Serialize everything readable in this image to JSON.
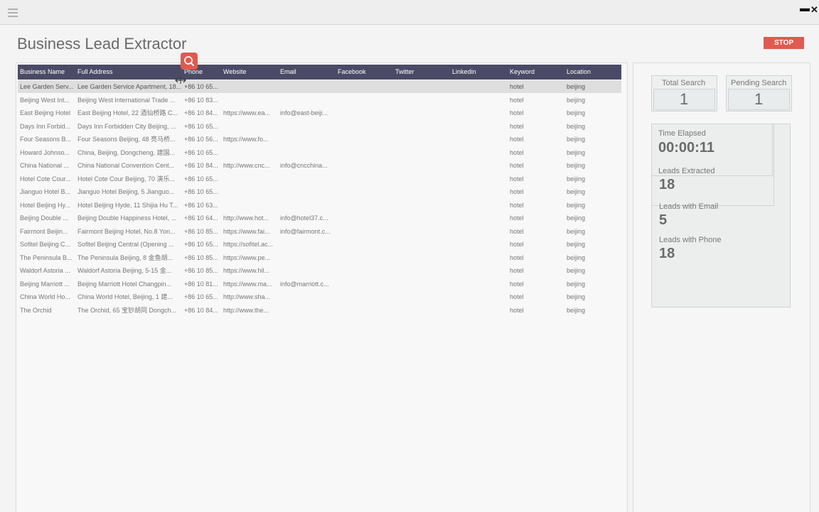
{
  "app": {
    "title": "Business Lead Extractor",
    "stop_label": "STOP",
    "accent_color": "#e05a4f",
    "header_color": "#4b4a66"
  },
  "icons": {
    "menu": "hamburger-icon",
    "minimize": "minimize-icon",
    "close": "close-icon",
    "search": "search-icon",
    "resize": "column-resize-cursor-icon"
  },
  "window": {
    "minimize_glyph": "▬",
    "close_glyph": "✕"
  },
  "table": {
    "columns": [
      "Business Name",
      "Full Address",
      "Phone",
      "Website",
      "Email",
      "Facebook",
      "Twitter",
      "Linkedin",
      "Keyword",
      "Location"
    ],
    "rows": [
      [
        "Lee Garden Serv...",
        "Lee Garden Service Apartment, 18...",
        "+86 10 65...",
        "",
        "",
        "",
        "",
        "",
        "hotel",
        "beijing"
      ],
      [
        "Beijing West Int...",
        "Beijing West International Trade ...",
        "+86 10 83...",
        "",
        "",
        "",
        "",
        "",
        "hotel",
        "beijing"
      ],
      [
        "East Beijing Hotel",
        "East Beijing Hotel, 22 酒仙桥路 C...",
        "+86 10 84...",
        "https://www.ea...",
        "info@east-beiji...",
        "",
        "",
        "",
        "hotel",
        "beijing"
      ],
      [
        "Days Inn Forbid...",
        "Days Inn Forbidden City Beijing, ...",
        "+86 10 65...",
        "",
        "",
        "",
        "",
        "",
        "hotel",
        "beijing"
      ],
      [
        "Four Seasons B...",
        "Four Seasons Beijing, 48 亮马桥...",
        "+86 10 56...",
        "https://www.fo...",
        "",
        "",
        "",
        "",
        "hotel",
        "beijing"
      ],
      [
        "Howard Johnso...",
        "China, Beijing, Dongcheng, 建国...",
        "+86 10 65...",
        "",
        "",
        "",
        "",
        "",
        "hotel",
        "beijing"
      ],
      [
        "China National ...",
        "China National Convention Cent...",
        "+86 10 84...",
        "http://www.cnc...",
        "info@cncchina...",
        "",
        "",
        "",
        "hotel",
        "beijing"
      ],
      [
        "Hotel Cote Cour...",
        "Hotel Cote Cour Beijing, 70 演乐...",
        "+86 10 65...",
        "",
        "",
        "",
        "",
        "",
        "hotel",
        "beijing"
      ],
      [
        "Jianguo Hotel B...",
        "Jianguo Hotel Beijing, 5 Jianguo...",
        "+86 10 65...",
        "",
        "",
        "",
        "",
        "",
        "hotel",
        "beijing"
      ],
      [
        "Hotel Beijing Hy...",
        "Hotel Beijing Hyde, 11 Shijia Hu T...",
        "+86 10 63...",
        "",
        "",
        "",
        "",
        "",
        "hotel",
        "beijing"
      ],
      [
        "Beijing Double ...",
        "Beijing Double Happiness Hotel, ...",
        "+86 10 64...",
        "http://www.hot...",
        "info@hotel37.c...",
        "",
        "",
        "",
        "hotel",
        "beijing"
      ],
      [
        "Fairmont Beijin...",
        "Fairmont Beijing Hotel, No.8 Yon...",
        "+86 10 85...",
        "https://www.fai...",
        "info@fairmont.c...",
        "",
        "",
        "",
        "hotel",
        "beijing"
      ],
      [
        "Sofitel Beijing C...",
        "Sofitel Beijing Central (Opening ...",
        "+86 10 65...",
        "https://sofitel.ac...",
        "",
        "",
        "",
        "",
        "hotel",
        "beijing"
      ],
      [
        "The Peninsula B...",
        "The Peninsula Beijing, 8 金鱼胡...",
        "+86 10 85...",
        "https://www.pe...",
        "",
        "",
        "",
        "",
        "hotel",
        "beijing"
      ],
      [
        "Waldorf Astoria ...",
        "Waldorf Astoria Beijing, 5-15 金...",
        "+86 10 85...",
        "https://www.hil...",
        "",
        "",
        "",
        "",
        "hotel",
        "beijing"
      ],
      [
        "Beijing Marriott ...",
        "Beijing Marriott Hotel Changpin...",
        "+86 10 81...",
        "https://www.ma...",
        "info@marriott.c...",
        "",
        "",
        "",
        "hotel",
        "beijing"
      ],
      [
        "China World Ho...",
        "China World Hotel, Beijing, 1 建...",
        "+86 10 65...",
        "http://www.sha...",
        "",
        "",
        "",
        "",
        "hotel",
        "beijing"
      ],
      [
        "The Orchid",
        "The Orchid, 65 宝钞胡同 Dongch...",
        "+86 10 84...",
        "http://www.the...",
        "",
        "",
        "",
        "",
        "hotel",
        "beijing"
      ]
    ]
  },
  "stats": {
    "total_search_label": "Total Search",
    "total_search_value": "1",
    "pending_search_label": "Pending Search",
    "pending_search_value": "1",
    "time_elapsed_label": "Time Elapsed",
    "time_elapsed_value": "00:00:11",
    "leads_extracted_label": "Leads Extracted",
    "leads_extracted_value": "18",
    "leads_email_label": "Leads with Email",
    "leads_email_value": "5",
    "leads_phone_label": "Leads with Phone",
    "leads_phone_value": "18"
  }
}
